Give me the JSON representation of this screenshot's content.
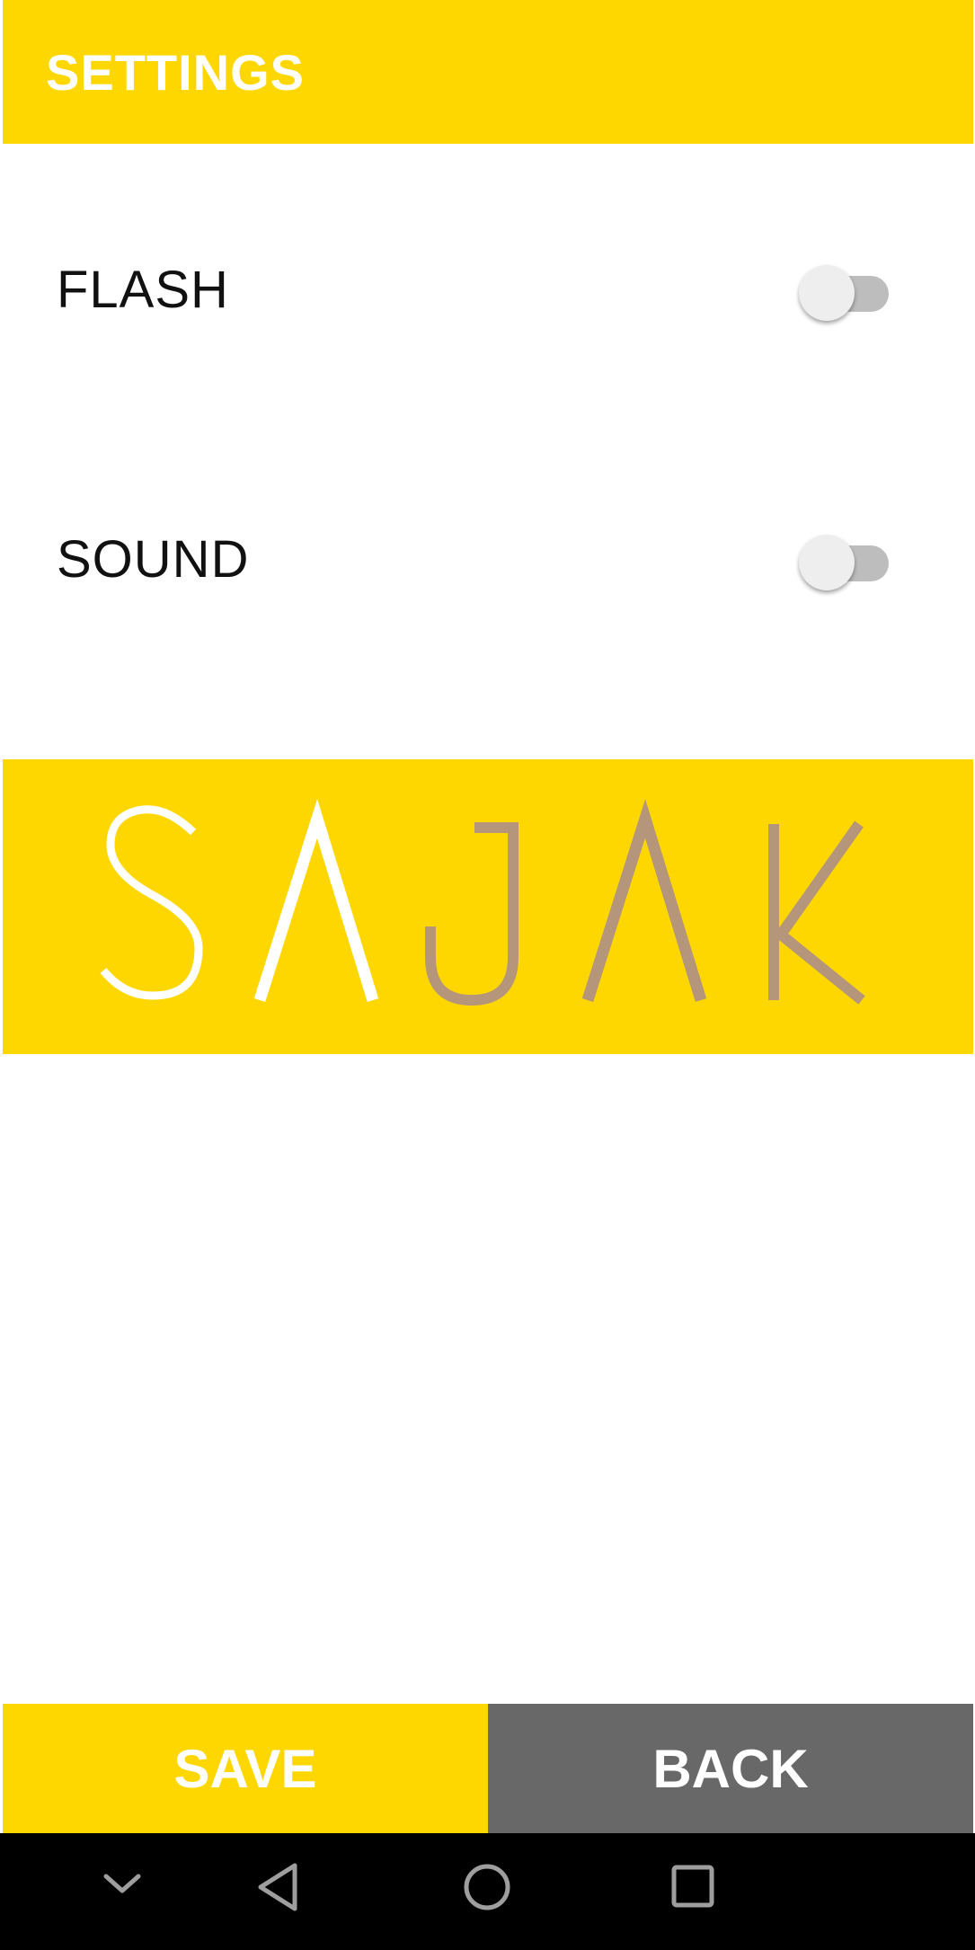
{
  "app_bar": {
    "title": "SETTINGS",
    "color": "#FFD700"
  },
  "settings": [
    {
      "label": "FLASH",
      "enabled": false
    },
    {
      "label": "SOUND",
      "enabled": false
    }
  ],
  "logo": {
    "text": "SAJAK",
    "primary_color": "#FFFFFF",
    "secondary_color": "#B5967A"
  },
  "actions": {
    "save_label": "SAVE",
    "back_label": "BACK",
    "save_color": "#FFD700",
    "back_color": "#686868"
  },
  "nav_bar": {
    "icons": [
      "chevron-down-icon",
      "back-triangle-icon",
      "home-circle-icon",
      "recents-square-icon"
    ]
  }
}
